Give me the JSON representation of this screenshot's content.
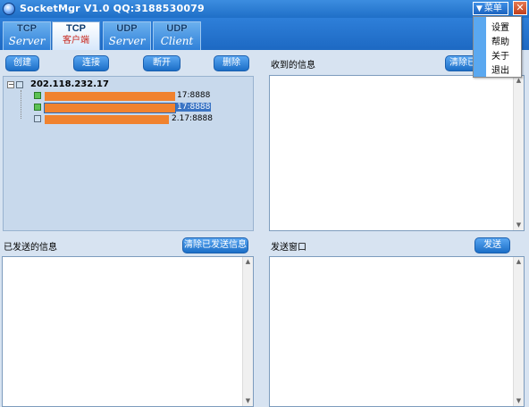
{
  "titlebar": {
    "title": "SocketMgr V1.0  QQ:3188530079",
    "menu_label": "菜单",
    "close_label": "✕"
  },
  "tabs": [
    {
      "top": "TCP",
      "bottom": "Server",
      "active": false
    },
    {
      "top": "TCP",
      "bottom": "客户端",
      "active": true
    },
    {
      "top": "UDP",
      "bottom": "Server",
      "active": false
    },
    {
      "top": "UDP",
      "bottom": "Client",
      "active": false
    }
  ],
  "toolbar": {
    "create": "创建",
    "connect": "连接",
    "disconnect": "断开",
    "delete": "删除"
  },
  "tree": {
    "root": "202.118.232.17",
    "items": [
      {
        "port": "17:8888",
        "selected": false
      },
      {
        "port": "17:8888",
        "selected": true
      },
      {
        "port": "2.17:8888",
        "selected": false
      }
    ]
  },
  "received": {
    "label": "收到的信息",
    "clear_button": "清除已"
  },
  "sent": {
    "label": "已发送的信息",
    "clear_button": "清除已发送信息"
  },
  "send_window": {
    "label": "发送窗口",
    "send_button": "发送"
  },
  "menu": {
    "items": [
      "设置",
      "帮助",
      "关于",
      "退出"
    ]
  },
  "colors": {
    "accent": "#1f6fc7",
    "connection_bar": "#f0822e"
  }
}
